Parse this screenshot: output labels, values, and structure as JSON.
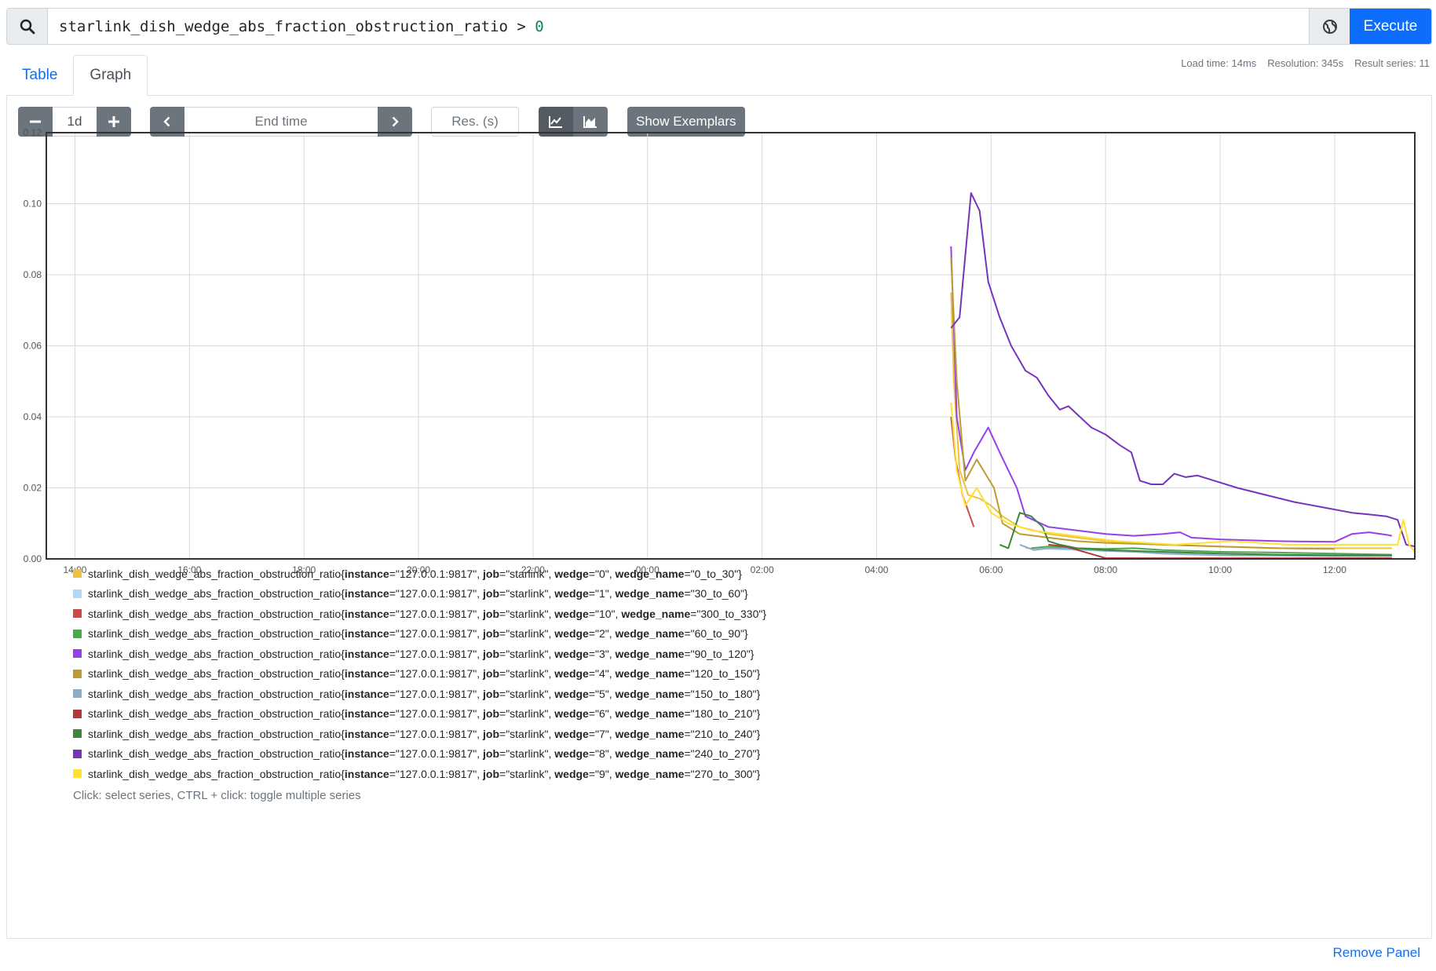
{
  "query": {
    "expr_metric": "starlink_dish_wedge_abs_fraction_obstruction_ratio",
    "expr_op": " > ",
    "expr_value": "0",
    "execute_label": "Execute"
  },
  "tabs": {
    "table": "Table",
    "graph": "Graph"
  },
  "stats": {
    "load_time": "Load time: 14ms",
    "resolution": "Resolution: 345s",
    "result_series": "Result series: 11"
  },
  "controls": {
    "range": "1d",
    "end_time_placeholder": "End time",
    "res_placeholder": "Res. (s)",
    "show_exemplars": "Show Exemplars"
  },
  "icons": {
    "search": "search-icon",
    "metrics_explorer": "globe-icon",
    "minus": "minus-icon",
    "plus": "plus-icon",
    "prev": "chevron-left-icon",
    "next": "chevron-right-icon",
    "line": "line-chart-icon",
    "stacked": "area-chart-icon"
  },
  "chart_data": {
    "type": "line",
    "x_ticks": [
      "14:00",
      "16:00",
      "18:00",
      "20:00",
      "22:00",
      "00:00",
      "02:00",
      "04:00",
      "06:00",
      "08:00",
      "10:00",
      "12:00"
    ],
    "x_tick_hours": [
      14,
      16,
      18,
      20,
      22,
      24,
      26,
      28,
      30,
      32,
      34,
      36
    ],
    "x_range_hours": [
      13.5,
      37.4
    ],
    "y_ticks": [
      "0.00",
      "0.02",
      "0.04",
      "0.06",
      "0.08",
      "0.10",
      "0.12"
    ],
    "ylim": [
      0,
      0.12
    ],
    "grid": true,
    "series": [
      {
        "name": "starlink_dish_wedge_abs_fraction_obstruction_ratio{instance=\"127.0.0.1:9817\", job=\"starlink\", wedge=\"0\", wedge_name=\"0_to_30\"}",
        "color": "#EDC240",
        "points": [
          [
            29.3,
            0.075
          ],
          [
            29.35,
            0.05
          ],
          [
            29.45,
            0.025
          ],
          [
            29.6,
            0.018
          ],
          [
            29.8,
            0.017
          ],
          [
            30.0,
            0.015
          ],
          [
            30.2,
            0.012
          ],
          [
            30.5,
            0.009
          ],
          [
            31.0,
            0.007
          ],
          [
            31.5,
            0.006
          ],
          [
            32,
            0.005
          ],
          [
            33,
            0.004
          ],
          [
            34,
            0.0035
          ],
          [
            35,
            0.003
          ],
          [
            36,
            0.003
          ],
          [
            37,
            0.003
          ]
        ]
      },
      {
        "name": "starlink_dish_wedge_abs_fraction_obstruction_ratio{instance=\"127.0.0.1:9817\", job=\"starlink\", wedge=\"1\", wedge_name=\"30_to_60\"}",
        "color": "#AFD8F8",
        "points": [
          [
            30.6,
            0.003
          ],
          [
            31,
            0.0028
          ],
          [
            32,
            0.0022
          ],
          [
            33,
            0.0018
          ],
          [
            34,
            0.0015
          ],
          [
            35,
            0.0012
          ],
          [
            36,
            0.0011
          ],
          [
            37,
            0.001
          ]
        ]
      },
      {
        "name": "starlink_dish_wedge_abs_fraction_obstruction_ratio{instance=\"127.0.0.1:9817\", job=\"starlink\", wedge=\"10\", wedge_name=\"300_to_330\"}",
        "color": "#CB4B4B",
        "points": [
          [
            29.3,
            0.04
          ],
          [
            29.38,
            0.028
          ],
          [
            29.5,
            0.018
          ],
          [
            29.7,
            0.009
          ]
        ]
      },
      {
        "name": "starlink_dish_wedge_abs_fraction_obstruction_ratio{instance=\"127.0.0.1:9817\", job=\"starlink\", wedge=\"2\", wedge_name=\"60_to_90\"}",
        "color": "#4DA74D",
        "points": [
          [
            30.7,
            0.003
          ],
          [
            31,
            0.0035
          ],
          [
            31.5,
            0.003
          ],
          [
            32,
            0.0028
          ],
          [
            32.5,
            0.003
          ],
          [
            33,
            0.0025
          ],
          [
            34,
            0.002
          ],
          [
            35,
            0.0018
          ],
          [
            36,
            0.0015
          ],
          [
            37,
            0.0012
          ]
        ]
      },
      {
        "name": "starlink_dish_wedge_abs_fraction_obstruction_ratio{instance=\"127.0.0.1:9817\", job=\"starlink\", wedge=\"3\", wedge_name=\"90_to_120\"}",
        "color": "#9440ED",
        "points": [
          [
            29.3,
            0.088
          ],
          [
            29.4,
            0.04
          ],
          [
            29.55,
            0.025
          ],
          [
            29.7,
            0.03
          ],
          [
            29.95,
            0.037
          ],
          [
            30.15,
            0.03
          ],
          [
            30.3,
            0.025
          ],
          [
            30.45,
            0.02
          ],
          [
            30.6,
            0.012
          ],
          [
            31.0,
            0.009
          ],
          [
            31.5,
            0.008
          ],
          [
            32.0,
            0.007
          ],
          [
            32.5,
            0.0065
          ],
          [
            33.0,
            0.007
          ],
          [
            33.3,
            0.0075
          ],
          [
            33.5,
            0.006
          ],
          [
            34,
            0.0055
          ],
          [
            35,
            0.005
          ],
          [
            36,
            0.0048
          ],
          [
            36.3,
            0.007
          ],
          [
            36.6,
            0.0075
          ],
          [
            36.9,
            0.0068
          ],
          [
            37.0,
            0.0065
          ]
        ]
      },
      {
        "name": "starlink_dish_wedge_abs_fraction_obstruction_ratio{instance=\"127.0.0.1:9817\", job=\"starlink\", wedge=\"4\", wedge_name=\"120_to_150\"}",
        "color": "#BD9B33",
        "points": [
          [
            29.3,
            0.085
          ],
          [
            29.4,
            0.05
          ],
          [
            29.55,
            0.022
          ],
          [
            29.75,
            0.028
          ],
          [
            29.9,
            0.024
          ],
          [
            30.05,
            0.02
          ],
          [
            30.2,
            0.01
          ],
          [
            30.5,
            0.007
          ],
          [
            31.0,
            0.006
          ],
          [
            31.5,
            0.005
          ],
          [
            32,
            0.0045
          ],
          [
            33,
            0.004
          ],
          [
            34,
            0.0035
          ],
          [
            35,
            0.003
          ],
          [
            36,
            0.0028
          ]
        ]
      },
      {
        "name": "starlink_dish_wedge_abs_fraction_obstruction_ratio{instance=\"127.0.0.1:9817\", job=\"starlink\", wedge=\"5\", wedge_name=\"150_to_180\"}",
        "color": "#8CACC6",
        "points": [
          [
            30.5,
            0.004
          ],
          [
            30.75,
            0.0025
          ],
          [
            31.0,
            0.003
          ],
          [
            31.5,
            0.0028
          ],
          [
            32,
            0.0023
          ],
          [
            32.5,
            0.002
          ],
          [
            33,
            0.0015
          ],
          [
            34,
            0.001
          ],
          [
            35,
            0.0009
          ],
          [
            36,
            0.0008
          ],
          [
            37,
            0.0008
          ]
        ]
      },
      {
        "name": "starlink_dish_wedge_abs_fraction_obstruction_ratio{instance=\"127.0.0.1:9817\", job=\"starlink\", wedge=\"6\", wedge_name=\"180_to_210\"}",
        "color": "#AF3A3A",
        "points": [
          [
            31.0,
            0.004
          ],
          [
            31.3,
            0.0035
          ],
          [
            32,
            0.0002
          ],
          [
            33,
            0.0002
          ],
          [
            34,
            0.0002
          ],
          [
            35,
            0.0002
          ],
          [
            36,
            0.0002
          ],
          [
            37,
            0.0002
          ]
        ]
      },
      {
        "name": "starlink_dish_wedge_abs_fraction_obstruction_ratio{instance=\"127.0.0.1:9817\", job=\"starlink\", wedge=\"7\", wedge_name=\"210_to_240\"}",
        "color": "#3D853D",
        "points": [
          [
            30.15,
            0.004
          ],
          [
            30.3,
            0.003
          ],
          [
            30.5,
            0.013
          ],
          [
            30.7,
            0.012
          ],
          [
            30.9,
            0.009
          ],
          [
            31.0,
            0.005
          ],
          [
            31.2,
            0.004
          ],
          [
            31.5,
            0.003
          ],
          [
            32,
            0.0025
          ],
          [
            33,
            0.002
          ],
          [
            34,
            0.0015
          ],
          [
            35,
            0.0012
          ],
          [
            36,
            0.001
          ],
          [
            37,
            0.001
          ]
        ]
      },
      {
        "name": "starlink_dish_wedge_abs_fraction_obstruction_ratio{instance=\"127.0.0.1:9817\", job=\"starlink\", wedge=\"8\", wedge_name=\"240_to_270\"}",
        "color": "#7633BD",
        "points": [
          [
            29.3,
            0.065
          ],
          [
            29.45,
            0.068
          ],
          [
            29.65,
            0.103
          ],
          [
            29.8,
            0.098
          ],
          [
            29.95,
            0.078
          ],
          [
            30.15,
            0.068
          ],
          [
            30.35,
            0.06
          ],
          [
            30.6,
            0.053
          ],
          [
            30.8,
            0.051
          ],
          [
            31.0,
            0.046
          ],
          [
            31.2,
            0.042
          ],
          [
            31.35,
            0.043
          ],
          [
            31.55,
            0.04
          ],
          [
            31.75,
            0.037
          ],
          [
            32.0,
            0.035
          ],
          [
            32.25,
            0.032
          ],
          [
            32.45,
            0.03
          ],
          [
            32.6,
            0.022
          ],
          [
            32.8,
            0.021
          ],
          [
            33.0,
            0.021
          ],
          [
            33.2,
            0.024
          ],
          [
            33.4,
            0.023
          ],
          [
            33.6,
            0.0235
          ],
          [
            33.9,
            0.022
          ],
          [
            34.3,
            0.02
          ],
          [
            34.8,
            0.018
          ],
          [
            35.3,
            0.016
          ],
          [
            35.8,
            0.0145
          ],
          [
            36.3,
            0.013
          ],
          [
            36.6,
            0.0125
          ],
          [
            36.9,
            0.012
          ],
          [
            37.1,
            0.011
          ],
          [
            37.25,
            0.004
          ],
          [
            38.0,
            0.0035
          ],
          [
            38.5,
            0.003
          ]
        ]
      },
      {
        "name": "starlink_dish_wedge_abs_fraction_obstruction_ratio{instance=\"127.0.0.1:9817\", job=\"starlink\", wedge=\"9\", wedge_name=\"270_to_300\"}",
        "color": "#FFE033",
        "points": [
          [
            29.3,
            0.044
          ],
          [
            29.4,
            0.025
          ],
          [
            29.55,
            0.015
          ],
          [
            29.75,
            0.02
          ],
          [
            30.0,
            0.013
          ],
          [
            30.3,
            0.01
          ],
          [
            30.7,
            0.008
          ],
          [
            31.2,
            0.007
          ],
          [
            31.7,
            0.006
          ],
          [
            32.2,
            0.005
          ],
          [
            32.7,
            0.0045
          ],
          [
            33.2,
            0.004
          ],
          [
            33.7,
            0.0045
          ],
          [
            34.2,
            0.005
          ],
          [
            34.7,
            0.0045
          ],
          [
            35.2,
            0.004
          ],
          [
            35.7,
            0.004
          ],
          [
            36.2,
            0.004
          ],
          [
            36.7,
            0.004
          ],
          [
            37.1,
            0.004
          ],
          [
            37.2,
            0.011
          ],
          [
            37.3,
            0.004
          ],
          [
            37.4,
            0.002
          ]
        ]
      }
    ]
  },
  "legend": {
    "metric": "starlink_dish_wedge_abs_fraction_obstruction_ratio",
    "hint": "Click: select series, CTRL + click: toggle multiple series",
    "items": [
      {
        "instance": "127.0.0.1:9817",
        "job": "starlink",
        "wedge": "0",
        "wedge_name": "0_to_30"
      },
      {
        "instance": "127.0.0.1:9817",
        "job": "starlink",
        "wedge": "1",
        "wedge_name": "30_to_60"
      },
      {
        "instance": "127.0.0.1:9817",
        "job": "starlink",
        "wedge": "10",
        "wedge_name": "300_to_330"
      },
      {
        "instance": "127.0.0.1:9817",
        "job": "starlink",
        "wedge": "2",
        "wedge_name": "60_to_90"
      },
      {
        "instance": "127.0.0.1:9817",
        "job": "starlink",
        "wedge": "3",
        "wedge_name": "90_to_120"
      },
      {
        "instance": "127.0.0.1:9817",
        "job": "starlink",
        "wedge": "4",
        "wedge_name": "120_to_150"
      },
      {
        "instance": "127.0.0.1:9817",
        "job": "starlink",
        "wedge": "5",
        "wedge_name": "150_to_180"
      },
      {
        "instance": "127.0.0.1:9817",
        "job": "starlink",
        "wedge": "6",
        "wedge_name": "180_to_210"
      },
      {
        "instance": "127.0.0.1:9817",
        "job": "starlink",
        "wedge": "7",
        "wedge_name": "210_to_240"
      },
      {
        "instance": "127.0.0.1:9817",
        "job": "starlink",
        "wedge": "8",
        "wedge_name": "240_to_270"
      },
      {
        "instance": "127.0.0.1:9817",
        "job": "starlink",
        "wedge": "9",
        "wedge_name": "270_to_300"
      }
    ]
  },
  "footer": {
    "remove_panel": "Remove Panel"
  }
}
